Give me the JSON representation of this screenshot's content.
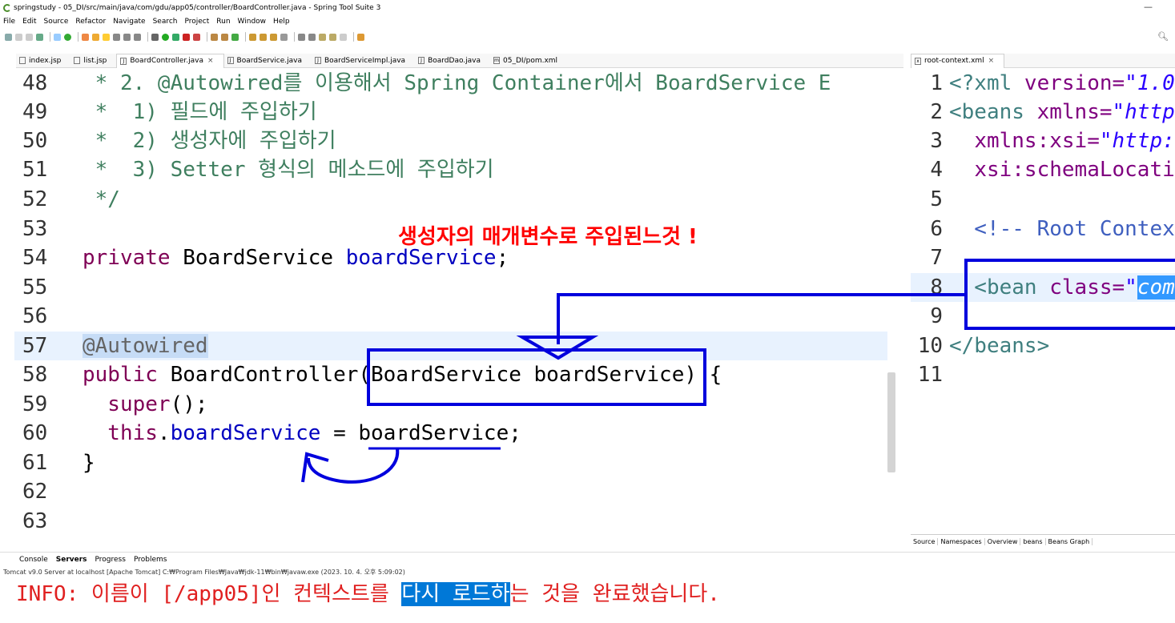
{
  "window": {
    "title": "springstudy - 05_DI/src/main/java/com/gdu/app05/controller/BoardController.java - Spring Tool Suite 3",
    "minimize": "—"
  },
  "menubar": [
    "File",
    "Edit",
    "Source",
    "Refactor",
    "Navigate",
    "Search",
    "Project",
    "Run",
    "Window",
    "Help"
  ],
  "editor_tabs": [
    {
      "label": "index.jsp",
      "active": false
    },
    {
      "label": "list.jsp",
      "active": false
    },
    {
      "label": "BoardController.java",
      "active": true
    },
    {
      "label": "BoardService.java",
      "active": false
    },
    {
      "label": "BoardServiceImpl.java",
      "active": false
    },
    {
      "label": "BoardDao.java",
      "active": false
    },
    {
      "label": "05_DI/pom.xml",
      "active": false
    }
  ],
  "xml_tab": {
    "label": "root-context.xml"
  },
  "java_lines": [
    {
      "n": "48",
      "text": " * 2. @Autowired를 이용해서 Spring Container에서 BoardService E"
    },
    {
      "n": "49",
      "text": " *  1) 필드에 주입하기"
    },
    {
      "n": "50",
      "text": " *  2) 생성자에 주입하기"
    },
    {
      "n": "51",
      "text": " *  3) Setter 형식의 메소드에 주입하기"
    },
    {
      "n": "52",
      "text": " */"
    },
    {
      "n": "53",
      "text": ""
    },
    {
      "n": "54",
      "kw": "private",
      "rest": " BoardService ",
      "fld": "boardService",
      "tail": ";"
    },
    {
      "n": "55",
      "text": ""
    },
    {
      "n": "56",
      "text": ""
    },
    {
      "n": "57",
      "annot": "@Autowired"
    },
    {
      "n": "58",
      "kw": "public",
      "rest": " BoardController(BoardService boardService) {"
    },
    {
      "n": "59",
      "kw": "  super",
      "rest": "();"
    },
    {
      "n": "60",
      "kw": "  this",
      "rest": ".",
      "fld": "boardService",
      "tail": " = boardService;"
    },
    {
      "n": "61",
      "text": "}"
    },
    {
      "n": "62",
      "text": ""
    },
    {
      "n": "63",
      "text": ""
    }
  ],
  "xml_lines": [
    {
      "n": "1",
      "a": "<?xml ",
      "b": "version=",
      "c": "\"1.0"
    },
    {
      "n": "2",
      "a": "<beans ",
      "b": "xmlns=",
      "c": "\"http"
    },
    {
      "n": "3",
      "a": "  ",
      "b": "xmlns:xsi=",
      "c": "\"http:"
    },
    {
      "n": "4",
      "a": "  ",
      "b": "xsi:schemaLocati",
      "c": ""
    },
    {
      "n": "5",
      "a": "",
      "b": "",
      "c": ""
    },
    {
      "n": "6",
      "cm": "  <!-- Root Contex"
    },
    {
      "n": "7",
      "a": "",
      "b": "",
      "c": ""
    },
    {
      "n": "8",
      "a": "  <bean ",
      "b": "class=",
      "c": "\"",
      "sel": "com"
    },
    {
      "n": "9",
      "a": "",
      "b": "",
      "c": ""
    },
    {
      "n": "10",
      "a": "</beans>",
      "b": "",
      "c": ""
    },
    {
      "n": "11",
      "a": "",
      "b": "",
      "c": ""
    }
  ],
  "xml_bottom_tabs": [
    "Source",
    "Namespaces",
    "Overview",
    "beans",
    "Beans Graph"
  ],
  "console": {
    "tabs": [
      "Console",
      "Servers",
      "Progress",
      "Problems"
    ],
    "description": "Tomcat v9.0 Server at localhost [Apache Tomcat] C:₩Program Files₩Java₩jdk-11₩bin₩javaw.exe  (2023. 10. 4. 오후 5:09:02)",
    "output_before": "INFO: 이름이 [/app05]인 컨텍스트를 ",
    "output_selected": "다시 로드하",
    "output_after": "는 것을 완료했습니다."
  },
  "annotation": {
    "text": "생성자의 매개변수로 주입된느것 !",
    "color": "#ff0000",
    "box_color": "#0000dd"
  }
}
